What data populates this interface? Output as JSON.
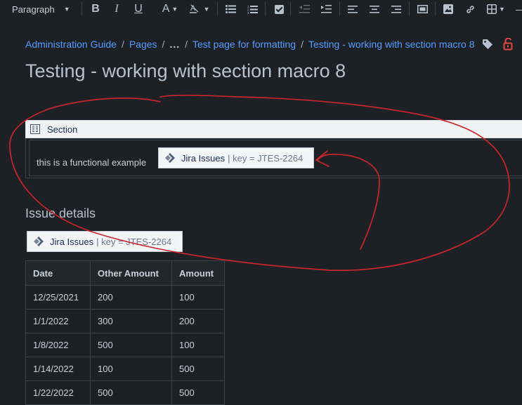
{
  "toolbar": {
    "paragraph_style": "Paragraph",
    "icons": [
      "bold-icon",
      "italic-icon",
      "underline-icon",
      "text-color-icon",
      "clear-formatting-icon",
      "bullet-list-icon",
      "numbered-list-icon",
      "task-list-icon",
      "outdent-icon",
      "indent-icon",
      "align-left-icon",
      "align-center-icon",
      "align-right-icon",
      "page-layout-icon",
      "image-icon",
      "link-icon",
      "table-icon",
      "insert-more-icon"
    ],
    "bold_glyph": "B",
    "italic_glyph": "I",
    "underline_glyph": "U",
    "text_color_glyph": "A"
  },
  "breadcrumb": {
    "items": [
      "Administration Guide",
      "Pages",
      "...",
      "Test page for formatting",
      "Testing - working with section macro 8"
    ],
    "separator": "/"
  },
  "page": {
    "title": "Testing - working with section macro 8"
  },
  "section_macro": {
    "label": "Section",
    "body_text": "this is a functional example"
  },
  "jira_macro": {
    "name": "Jira Issues",
    "params": "| key = JTES-2264"
  },
  "issue_details": {
    "heading": "Issue details"
  },
  "table": {
    "headers": [
      "Date",
      "Other Amount",
      "Amount"
    ],
    "rows": [
      [
        "12/25/2021",
        "200",
        "100"
      ],
      [
        "1/1/2022",
        "300",
        "200"
      ],
      [
        "1/8/2022",
        "500",
        "100"
      ],
      [
        "1/14/2022",
        "100",
        "500"
      ],
      [
        "1/22/2022",
        "500",
        "500"
      ]
    ]
  },
  "colors": {
    "background": "#1d2125",
    "link": "#579dff",
    "annotation": "#c9252c",
    "lock": "#e2483d"
  }
}
